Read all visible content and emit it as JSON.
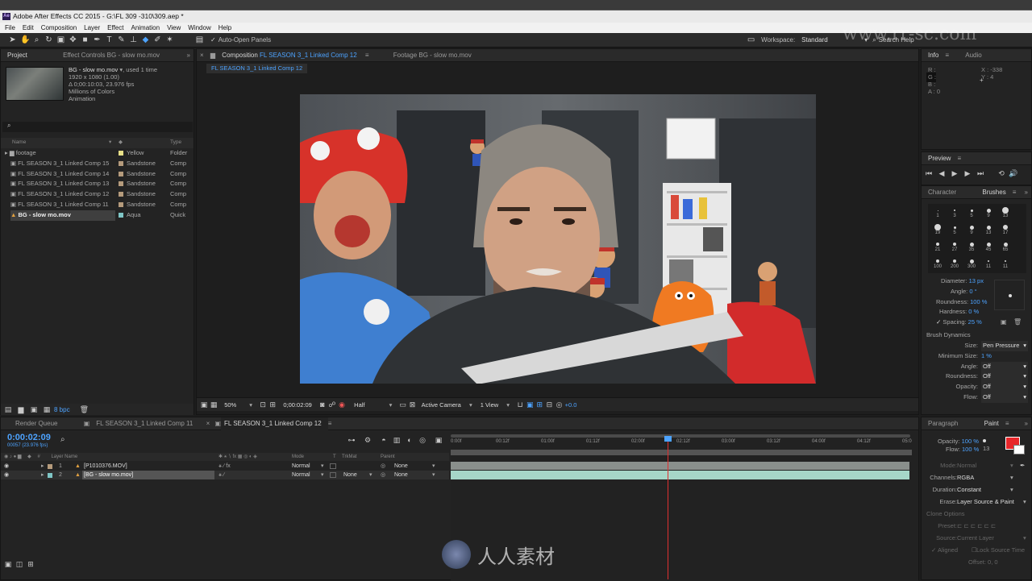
{
  "window": {
    "title": "Adobe After Effects CC 2015 - G:\\FL 309 -310\\309.aep *",
    "icon": "Ae"
  },
  "menu": [
    "File",
    "Edit",
    "Composition",
    "Layer",
    "Effect",
    "Animation",
    "View",
    "Window",
    "Help"
  ],
  "toolbar": {
    "auto_open": "Auto-Open Panels",
    "workspace_label": "Workspace:",
    "workspace_value": "Standard",
    "search_help": "Search Help"
  },
  "project": {
    "tabs": [
      "Project",
      "Effect Controls BG - slow mo.mov"
    ],
    "selected": {
      "name": "BG - slow mo.mov",
      "used": ", used 1 time",
      "line1": "1920 x 1080 (1.00)",
      "line2": "Δ 0;00:10:03, 23.976 fps",
      "line3": "Millions of Colors",
      "line4": "Animation"
    },
    "columns": {
      "name": "Name",
      "type": "Type"
    },
    "items": [
      {
        "name": "footage",
        "label": "Yellow",
        "type": "Folder",
        "color": "#e8e088"
      },
      {
        "name": "FL SEASON 3_1 Linked Comp 15",
        "label": "Sandstone",
        "type": "Comp",
        "color": "#b59b7c"
      },
      {
        "name": "FL SEASON 3_1 Linked Comp 14",
        "label": "Sandstone",
        "type": "Comp",
        "color": "#b59b7c"
      },
      {
        "name": "FL SEASON 3_1 Linked Comp 13",
        "label": "Sandstone",
        "type": "Comp",
        "color": "#b59b7c"
      },
      {
        "name": "FL SEASON 3_1 Linked Comp 12",
        "label": "Sandstone",
        "type": "Comp",
        "color": "#b59b7c"
      },
      {
        "name": "FL SEASON 3_1 Linked Comp 11",
        "label": "Sandstone",
        "type": "Comp",
        "color": "#b59b7c"
      },
      {
        "name": "BG - slow mo.mov",
        "label": "Aqua",
        "type": "Quick",
        "color": "#7fc6c6"
      }
    ],
    "bpc": "8 bpc"
  },
  "comp": {
    "tab_prefix": "Composition",
    "tab_name": "FL SEASON 3_1 Linked Comp 12",
    "footage_tab": "Footage BG - slow mo.mov",
    "sub_tab": "FL SEASON 3_1 Linked Comp 12",
    "zoom": "50%",
    "timecode": "0;00:02:09",
    "resolution": "Half",
    "camera": "Active Camera",
    "view": "1 View",
    "exposure": "+0.0"
  },
  "info": {
    "tabs": [
      "Info",
      "Audio"
    ],
    "r": "R :",
    "g": "G :",
    "b": "B :",
    "a": "A : 0",
    "x": "X : -338",
    "y": "Y : 4"
  },
  "preview": {
    "title": "Preview"
  },
  "brushes": {
    "tabs": [
      "Character",
      "Brushes"
    ],
    "sizes": [
      "1",
      "3",
      "5",
      "9",
      "13",
      "19",
      "5",
      "9",
      "13",
      "17",
      "21",
      "27",
      "35",
      "45",
      "65",
      "100",
      "200",
      "300",
      "11",
      "11"
    ],
    "diameter_label": "Diameter:",
    "diameter": "13 px",
    "angle_label": "Angle:",
    "angle": "0 °",
    "roundness_label": "Roundness:",
    "roundness": "100 %",
    "hardness_label": "Hardness:",
    "hardness": "0 %",
    "spacing_label": "Spacing:",
    "spacing": "25 %",
    "dynamics": "Brush Dynamics",
    "dyn": [
      {
        "label": "Size:",
        "value": "Pen Pressure"
      },
      {
        "label": "Minimum Size:",
        "value": "1 %"
      },
      {
        "label": "Angle:",
        "value": "Off"
      },
      {
        "label": "Roundness:",
        "value": "Off"
      },
      {
        "label": "Opacity:",
        "value": "Off"
      },
      {
        "label": "Flow:",
        "value": "Off"
      }
    ]
  },
  "timeline": {
    "tabs": [
      "Render Queue",
      "FL SEASON 3_1 Linked Comp 11",
      "FL SEASON 3_1 Linked Comp 12"
    ],
    "timecode": "0:00:02:09",
    "fps": "00057 (23.976 fps)",
    "headers": {
      "num": "#",
      "layer": "Layer Name",
      "mode": "Mode",
      "t": "T",
      "trkmat": "TrkMat",
      "parent": "Parent"
    },
    "layers": [
      {
        "num": "1",
        "name": "[P1010376.MOV]",
        "mode": "Normal",
        "trkmat": "",
        "parent": "None"
      },
      {
        "num": "2",
        "name": "[BG - slow mo.mov]",
        "mode": "Normal",
        "trkmat": "None",
        "parent": "None"
      }
    ],
    "ruler": [
      "0:00f",
      "00:12f",
      "01:00f",
      "01:12f",
      "02:00f",
      "02:12f",
      "03:00f",
      "03:12f",
      "04:00f",
      "04:12f",
      "05:0"
    ],
    "playhead_fraction": 0.472
  },
  "paint": {
    "tabs": [
      "Paragraph",
      "Paint"
    ],
    "opacity_label": "Opacity:",
    "opacity": "100 %",
    "flow_label": "Flow:",
    "flow": "100 %",
    "size": "13",
    "mode_label": "Mode:",
    "mode": "Normal",
    "channels_label": "Channels:",
    "channels": "RGBA",
    "duration_label": "Duration:",
    "duration": "Constant",
    "erase_label": "Erase:",
    "erase": "Layer Source & Paint",
    "clone_options": "Clone Options",
    "preset_label": "Preset:",
    "source_label": "Source:",
    "source": "Current Layer",
    "aligned": "Aligned",
    "lock_source": "Lock Source Time",
    "offset": "Offset: 0, 0",
    "fg_color": "#e8262a"
  },
  "watermark": {
    "site": "www.rr-sc.com",
    "brand": "人人素材"
  }
}
